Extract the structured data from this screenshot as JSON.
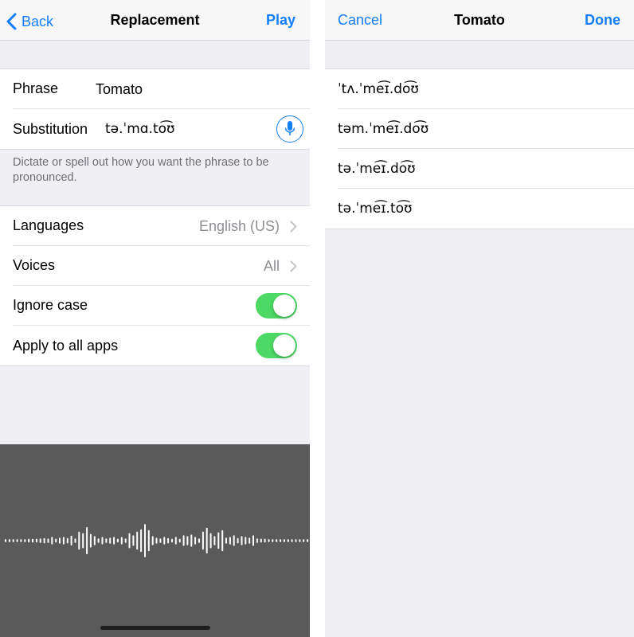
{
  "left": {
    "nav": {
      "back_label": "Back",
      "title": "Replacement",
      "action_label": "Play"
    },
    "phrase": {
      "label": "Phrase",
      "value": "Tomato"
    },
    "substitution": {
      "label": "Substitution",
      "value": "tə.ˈmɑ.to͡ʊ",
      "mic_icon": "microphone-icon"
    },
    "note": "Dictate or spell out how you want the phrase to be pronounced.",
    "settings": [
      {
        "label": "Languages",
        "value": "English (US)",
        "type": "disclosure"
      },
      {
        "label": "Voices",
        "value": "All",
        "type": "disclosure"
      },
      {
        "label": "Ignore case",
        "type": "toggle",
        "on": true
      },
      {
        "label": "Apply to all apps",
        "type": "toggle",
        "on": true
      }
    ],
    "dictation": {
      "waveform_levels": [
        0.04,
        0.04,
        0.04,
        0.04,
        0.04,
        0.04,
        0.05,
        0.05,
        0.05,
        0.06,
        0.07,
        0.06,
        0.1,
        0.05,
        0.08,
        0.1,
        0.07,
        0.13,
        0.06,
        0.24,
        0.2,
        0.36,
        0.18,
        0.12,
        0.06,
        0.1,
        0.06,
        0.08,
        0.1,
        0.05,
        0.1,
        0.06,
        0.2,
        0.14,
        0.24,
        0.3,
        0.44,
        0.28,
        0.12,
        0.08,
        0.06,
        0.1,
        0.07,
        0.05,
        0.1,
        0.05,
        0.14,
        0.12,
        0.16,
        0.1,
        0.06,
        0.24,
        0.34,
        0.2,
        0.12,
        0.22,
        0.28,
        0.08,
        0.1,
        0.14,
        0.07,
        0.12,
        0.1,
        0.08,
        0.14,
        0.06,
        0.05,
        0.05,
        0.04,
        0.04,
        0.04,
        0.04,
        0.04,
        0.04,
        0.04,
        0.04,
        0.04,
        0.04,
        0.04
      ],
      "colors": {
        "background": "#5a5a5a",
        "bars": "#ffffff"
      }
    }
  },
  "right": {
    "nav": {
      "cancel_label": "Cancel",
      "title": "Tomato",
      "done_label": "Done"
    },
    "pronunciations": [
      "ˈtʌ.ˈme͡ɪ.do͡ʊ",
      "təm.ˈme͡ɪ.do͡ʊ",
      "tə.ˈme͡ɪ.do͡ʊ",
      "tə.ˈme͡ɪ.to͡ʊ"
    ]
  },
  "colors": {
    "accent": "#147efb",
    "toggle_on": "#4cd964",
    "grouped_bg": "#efeff4"
  }
}
